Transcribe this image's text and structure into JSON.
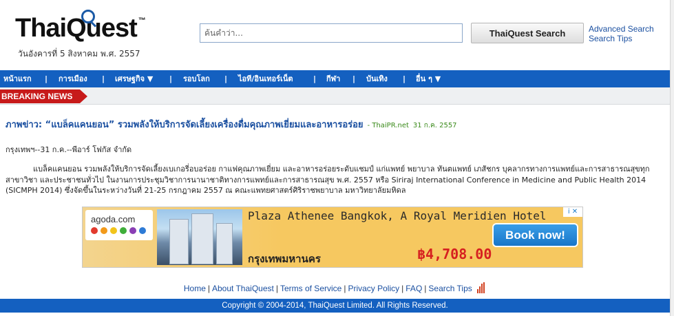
{
  "logo": {
    "text_before": "Thai",
    "text_after": "Quest",
    "tm": "™",
    "date": "วันอังคารที่ 5 สิงหาคม พ.ศ. 2557"
  },
  "search": {
    "placeholder": "ค้นคำว่า...",
    "button_label": "ThaiQuest Search",
    "advanced_label": "Advanced Search",
    "tips_label": "Search Tips"
  },
  "nav": {
    "items": [
      {
        "label": "หน้าแรก"
      },
      {
        "label": "การเมือง"
      },
      {
        "label": "เศรษฐกิจ ▼"
      },
      {
        "label": "รอบโลก"
      },
      {
        "label": "ไอที/อินเทอร์เน็ต"
      },
      {
        "label": "กีฬา"
      },
      {
        "label": "บันเทิง"
      },
      {
        "label": "อื่น ๆ ▼"
      }
    ],
    "separator": "|"
  },
  "breaking_news": {
    "label": "BREAKING NEWS"
  },
  "article": {
    "headline": "ภาพข่าว: “แบล็คแคนยอน” รวมพลังให้บริการจัดเลี้ยงเครื่องดื่มคุณภาพเยี่ยมและอาหารอร่อย",
    "source": "- ThaiPR.net",
    "date": "31 ก.ค. 2557",
    "dateline": "กรุงเทพฯ--31 ก.ค.--พีอาร์ โฟกัส จำกัด",
    "body": "แบล็คแคนยอน รวมพลังให้บริการจัดเลี้ยงเบเกอรี่อบอร่อย กาแฟคุณภาพเยี่ยม และอาหารอร่อยระดับแชมป์ แก่แพทย์ พยาบาล ทันตแพทย์ เภสัชกร บุคลากรทางการแพทย์และการสาธารณสุขทุกสาขาวิชา และประชาชนทั่วไป ในงานการประชุมวิชาการนานาชาติทางการแพทย์และการสาธารณสุข พ.ศ. 2557 หรือ Siriraj International Conference in Medicine and Public Health 2014 (SICMPH 2014) ซึ่งจัดขึ้นในระหว่างวันที่ 21-25 กรกฎาคม 2557 ณ คณะแพทยศาสตร์ศิริราชพยาบาล มหาวิทยาลัยมหิดล"
  },
  "ad": {
    "brand": "agoda.com",
    "hotel": "Plaza Athenee Bangkok, A Royal Meridien Hotel",
    "city": "กรุงเทพมหานคร",
    "price": "฿4,708.00",
    "cta": "Book now!",
    "choices": "i ✕",
    "dot_colors": [
      "#e23a2e",
      "#f29a1b",
      "#f2c41b",
      "#3fae3a",
      "#8a3fb5",
      "#2e7bd6"
    ]
  },
  "footer": {
    "links": [
      {
        "label": "Home"
      },
      {
        "label": "About ThaiQuest"
      },
      {
        "label": "Terms of Service"
      },
      {
        "label": "Privacy Policy"
      },
      {
        "label": "FAQ"
      },
      {
        "label": "Search Tips"
      }
    ],
    "separator": "|",
    "copyright": "Copyright © 2004-2014, ThaiQuest Limited. All Rights Reserved."
  },
  "colors": {
    "nav_blue": "#1460c0",
    "breaking_red": "#c71a1a",
    "link_blue": "#1a4fa0",
    "source_green": "#3a8a1a",
    "price_red": "#d62020"
  }
}
